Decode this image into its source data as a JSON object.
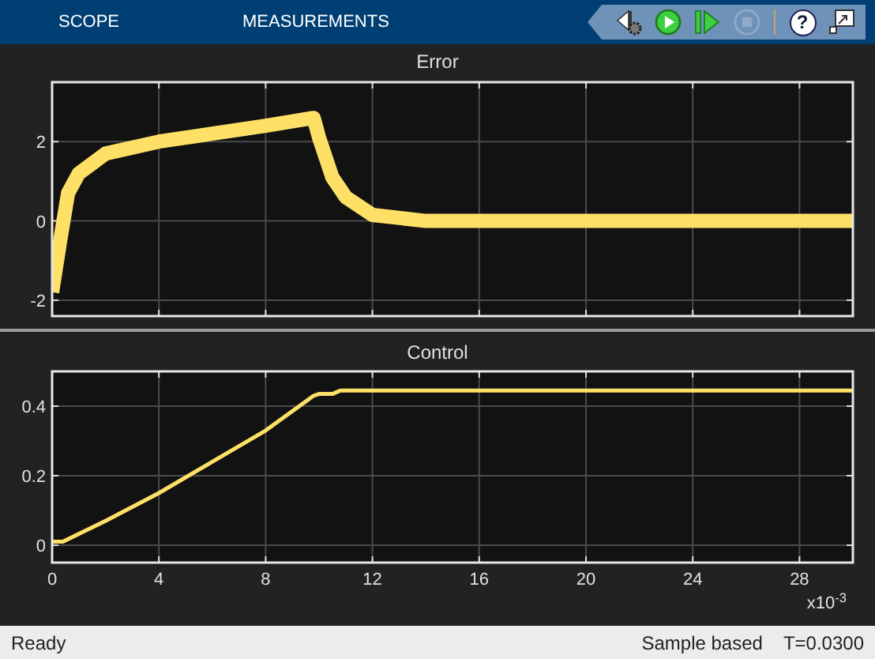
{
  "tabs": [
    {
      "label": "SCOPE",
      "selected": false
    },
    {
      "label": "MEASUREMENTS",
      "selected": false
    }
  ],
  "toolbar": [
    {
      "kind": "settings",
      "disabled": false
    },
    {
      "kind": "run",
      "disabled": false
    },
    {
      "kind": "step",
      "disabled": false
    },
    {
      "kind": "stop",
      "disabled": true
    },
    {
      "kind": "separator"
    },
    {
      "kind": "help",
      "label": "?",
      "disabled": false
    },
    {
      "kind": "undock",
      "disabled": false
    }
  ],
  "plots": [
    {
      "chart_data": {
        "type": "line",
        "title": "Error",
        "grid": true,
        "xlim": [
          0,
          30
        ],
        "ylim": [
          -2.4,
          3.5
        ],
        "yticks": [
          -2,
          0,
          2
        ],
        "x": [
          0,
          0.3,
          0.6,
          1,
          2,
          4,
          6,
          8,
          9.8,
          10,
          10.5,
          11,
          12,
          14,
          30
        ],
        "series": [
          {
            "color": "#ffe066",
            "values": [
              -1.8,
              -0.5,
              0.7,
              1.2,
              1.7,
              2.0,
              2.2,
              2.4,
              2.6,
              2.1,
              1.1,
              0.6,
              0.15,
              0,
              0
            ]
          }
        ]
      }
    },
    {
      "chart_data": {
        "type": "line",
        "title": "Control",
        "grid": true,
        "xlim": [
          0,
          30
        ],
        "ylim": [
          -0.05,
          0.5
        ],
        "xticks": [
          0,
          4,
          8,
          12,
          16,
          20,
          24,
          28
        ],
        "yticks": [
          0,
          0.2,
          0.4
        ],
        "x": [
          0,
          0.4,
          2,
          4,
          6,
          8,
          9.8,
          10,
          10.5,
          10.8,
          30
        ],
        "series": [
          {
            "color": "#ffe066",
            "values": [
              0.01,
              0.01,
              0.07,
              0.15,
              0.24,
              0.33,
              0.43,
              0.435,
              0.435,
              0.445,
              0.445
            ]
          }
        ]
      },
      "exponent_label": "x10$^{-3}$"
    }
  ],
  "status_bar": {
    "left": "Ready",
    "mode": "Sample based",
    "time": "T=0.0300"
  }
}
